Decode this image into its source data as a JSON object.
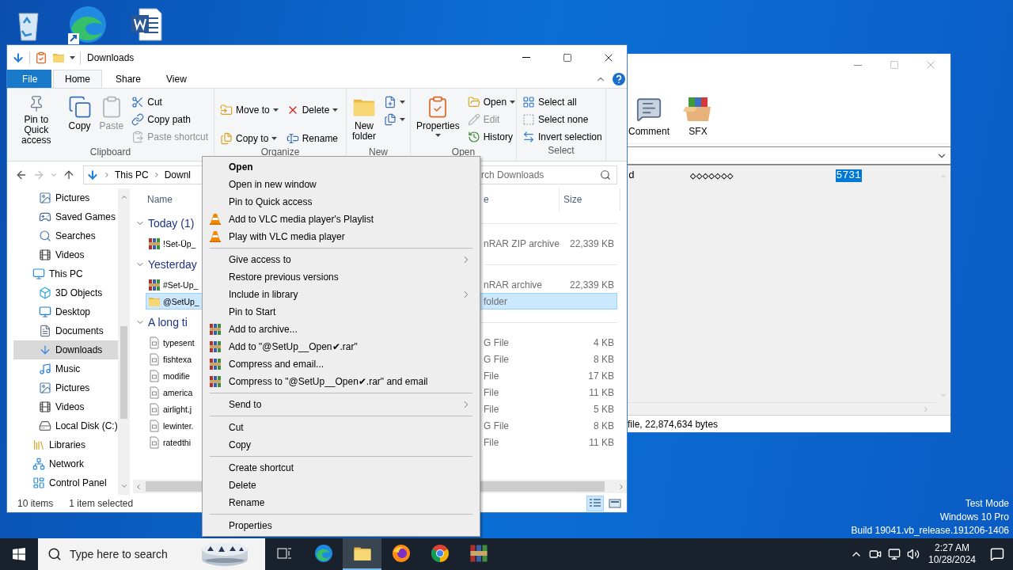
{
  "explorer": {
    "title": "Downloads",
    "tabs": [
      {
        "label": "File",
        "kind": "file",
        "selected": false
      },
      {
        "label": "Home",
        "kind": "tab",
        "selected": true
      },
      {
        "label": "Share",
        "kind": "tab",
        "selected": false
      },
      {
        "label": "View",
        "kind": "tab",
        "selected": false
      }
    ],
    "ribbon": [
      {
        "label": "Clipboard",
        "columns": [
          [
            {
              "kind": "large",
              "label": "Pin to Quick access",
              "disabled": false,
              "menu": false
            }
          ],
          [
            {
              "kind": "large",
              "label": "Copy",
              "disabled": false,
              "menu": false
            }
          ],
          [
            {
              "kind": "large",
              "label": "Paste",
              "disabled": true,
              "menu": false
            }
          ],
          [
            {
              "kind": "small",
              "label": "Cut",
              "disabled": false,
              "menu": false
            },
            {
              "kind": "small",
              "label": "Copy path",
              "disabled": false,
              "menu": false
            },
            {
              "kind": "small",
              "label": "Paste shortcut",
              "disabled": true,
              "menu": false
            }
          ]
        ]
      },
      {
        "label": "Organize",
        "columns": [
          [
            {
              "kind": "small",
              "label": "Move to",
              "disabled": false,
              "menu": true
            },
            {
              "kind": "small",
              "label": "Copy to",
              "disabled": false,
              "menu": true
            }
          ],
          [
            {
              "kind": "small",
              "label": "Delete",
              "disabled": false,
              "menu": true
            },
            {
              "kind": "small",
              "label": "Rename",
              "disabled": false,
              "menu": false
            }
          ]
        ]
      },
      {
        "label": "New",
        "columns": [
          [
            {
              "kind": "large",
              "label": "New folder",
              "disabled": false,
              "menu": false
            }
          ],
          [
            {
              "kind": "icon",
              "disabled": false,
              "menu": true
            },
            {
              "kind": "icon",
              "disabled": false,
              "menu": true
            }
          ]
        ]
      },
      {
        "label": "Open",
        "columns": [
          [
            {
              "kind": "large",
              "label": "Properties",
              "disabled": false,
              "menu": true
            }
          ],
          [
            {
              "kind": "small",
              "label": "Open",
              "disabled": false,
              "menu": true
            },
            {
              "kind": "small",
              "label": "Edit",
              "disabled": true,
              "menu": false
            },
            {
              "kind": "small",
              "label": "History",
              "disabled": false,
              "menu": false
            }
          ]
        ]
      },
      {
        "label": "Select",
        "columns": [
          [
            {
              "kind": "small",
              "label": "Select all",
              "disabled": false,
              "menu": false
            },
            {
              "kind": "small",
              "label": "Select none",
              "disabled": false,
              "menu": false
            },
            {
              "kind": "small",
              "label": "Invert selection",
              "disabled": false,
              "menu": false
            }
          ]
        ]
      }
    ],
    "address": {
      "path": [
        "This PC",
        "Downl"
      ],
      "search_placeholder": "rch Downloads"
    },
    "sidebar": {
      "items_above": [
        {
          "label": "Pictures",
          "selected": false
        },
        {
          "label": "Saved Games",
          "selected": false
        },
        {
          "label": "Searches",
          "selected": false
        },
        {
          "label": "Videos",
          "selected": false
        }
      ],
      "tree": [
        {
          "label": "This PC",
          "selected": false,
          "children": [
            {
              "label": "3D Objects",
              "selected": false
            },
            {
              "label": "Desktop",
              "selected": false
            },
            {
              "label": "Documents",
              "selected": false
            },
            {
              "label": "Downloads",
              "selected": true
            },
            {
              "label": "Music",
              "selected": false
            },
            {
              "label": "Pictures",
              "selected": false
            },
            {
              "label": "Videos",
              "selected": false
            },
            {
              "label": "Local Disk (C:)",
              "selected": false
            }
          ]
        },
        {
          "label": "Libraries",
          "selected": false
        },
        {
          "label": "Network",
          "selected": false
        },
        {
          "label": "Control Panel",
          "selected": false
        }
      ]
    },
    "columns": [
      "Name",
      "e",
      "Size"
    ],
    "groups": [
      {
        "label": "Today (1)",
        "expanded": true,
        "rows": [
          {
            "kind": "rar",
            "name": "!Set-Üp_",
            "type": "nRAR ZIP archive",
            "size": "22,339 KB",
            "selected": false
          }
        ]
      },
      {
        "label": "Yesterday",
        "expanded": true,
        "rows": [
          {
            "kind": "rar",
            "name": "#Set-Up_",
            "type": "nRAR archive",
            "size": "22,339 KB",
            "selected": false
          },
          {
            "kind": "folder",
            "name": "@SetUp_",
            "type": "folder",
            "selected": true
          }
        ]
      },
      {
        "label": "A long ti",
        "expanded": true,
        "rows": [
          {
            "kind": "file",
            "name": "typesent",
            "type": "G File",
            "size": "4 KB",
            "selected": false
          },
          {
            "kind": "file",
            "name": "fishtexa",
            "type": "G File",
            "size": "8 KB",
            "selected": false
          },
          {
            "kind": "file",
            "name": "modifie",
            "type": "File",
            "size": "17 KB",
            "selected": false
          },
          {
            "kind": "file",
            "name": "america",
            "type": "File",
            "size": "11 KB",
            "selected": false
          },
          {
            "kind": "file",
            "name": "airlight.j",
            "type": "File",
            "size": "5 KB",
            "selected": false
          },
          {
            "kind": "file",
            "name": "lewinter.",
            "type": "G File",
            "size": "8 KB",
            "selected": false
          },
          {
            "kind": "file",
            "name": "ratedthi",
            "type": "File",
            "size": "11 KB",
            "selected": false
          }
        ]
      }
    ],
    "status": {
      "count": "10 items",
      "selection": "1 item selected",
      "views": [
        {
          "kind": "details",
          "selected": true
        },
        {
          "kind": "tiles",
          "selected": false
        }
      ]
    }
  },
  "context_menu": [
    {
      "kind": "plain",
      "label": "Open",
      "default": true
    },
    {
      "kind": "plain",
      "label": "Open in new window"
    },
    {
      "kind": "plain",
      "label": "Pin to Quick access"
    },
    {
      "kind": "vlc",
      "label": "Add to VLC media player's Playlist"
    },
    {
      "kind": "vlc",
      "label": "Play with VLC media player"
    },
    {
      "kind": "separator"
    },
    {
      "kind": "submenu",
      "label": "Give access to"
    },
    {
      "kind": "plain",
      "label": "Restore previous versions"
    },
    {
      "kind": "submenu",
      "label": "Include in library"
    },
    {
      "kind": "plain",
      "label": "Pin to Start"
    },
    {
      "kind": "rar",
      "label": "Add to archive..."
    },
    {
      "kind": "rar",
      "label": "Add to \"@SetUp__Open✔.rar\""
    },
    {
      "kind": "rar",
      "label": "Compress and email..."
    },
    {
      "kind": "rar",
      "label": "Compress to \"@SetUp__Open✔.rar\" and email"
    },
    {
      "kind": "separator"
    },
    {
      "kind": "submenu",
      "label": "Send to"
    },
    {
      "kind": "separator"
    },
    {
      "kind": "plain",
      "label": "Cut"
    },
    {
      "kind": "plain",
      "label": "Copy"
    },
    {
      "kind": "separator"
    },
    {
      "kind": "plain",
      "label": "Create shortcut"
    },
    {
      "kind": "plain",
      "label": "Delete"
    },
    {
      "kind": "plain",
      "label": "Rename"
    },
    {
      "kind": "separator"
    },
    {
      "kind": "plain",
      "label": "Properties"
    }
  ],
  "winrar": {
    "toolbar": [
      "Comment",
      "SFX"
    ],
    "row": [
      {
        "text": "d",
        "selected": false
      },
      {
        "text": "◇◇◇◇◇◇◇",
        "selected": false
      },
      {
        "text": "5731",
        "selected": true
      }
    ],
    "status": "file, 22,874,634 bytes"
  },
  "watermark": [
    "Test Mode",
    "Windows 10 Pro",
    "Build 19041.vb_release.191206-1406"
  ],
  "taskbar": {
    "search_placeholder": "Type here to search",
    "apps": [
      {
        "kind": "taskview",
        "active": false
      },
      {
        "kind": "edge",
        "active": false
      },
      {
        "kind": "explorer",
        "active": true
      },
      {
        "kind": "firefox",
        "active": false
      },
      {
        "kind": "chrome",
        "active": false
      },
      {
        "kind": "winrar",
        "active": false
      }
    ],
    "time": "2:27 AM",
    "date": "10/28/2024"
  }
}
